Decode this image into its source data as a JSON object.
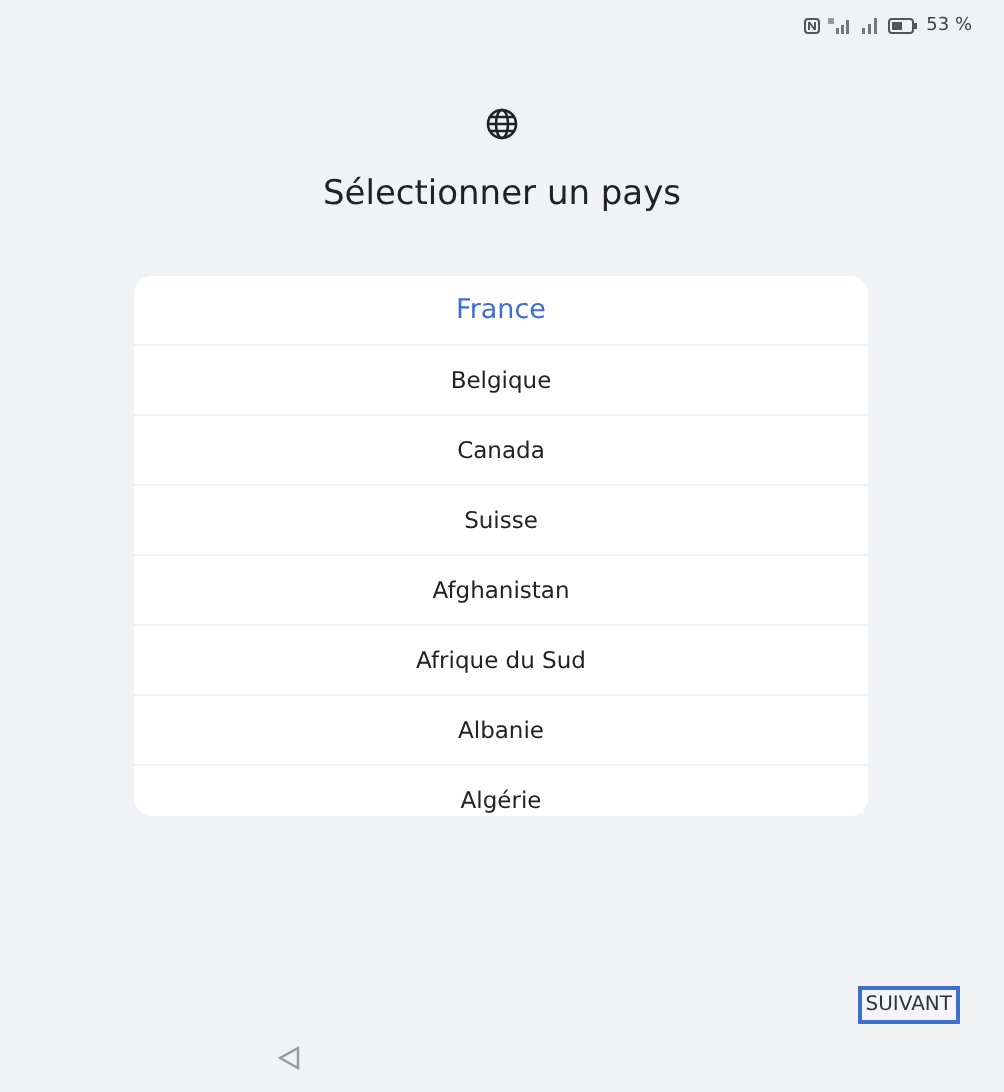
{
  "status_bar": {
    "battery": "53 %"
  },
  "title": "Sélectionner un pays",
  "countries": [
    {
      "name": "France",
      "selected": true
    },
    {
      "name": "Belgique",
      "selected": false
    },
    {
      "name": "Canada",
      "selected": false
    },
    {
      "name": "Suisse",
      "selected": false
    },
    {
      "name": "Afghanistan",
      "selected": false
    },
    {
      "name": "Afrique du Sud",
      "selected": false
    },
    {
      "name": "Albanie",
      "selected": false
    },
    {
      "name": "Algérie",
      "selected": false
    }
  ],
  "next_button": "SUIVANT"
}
